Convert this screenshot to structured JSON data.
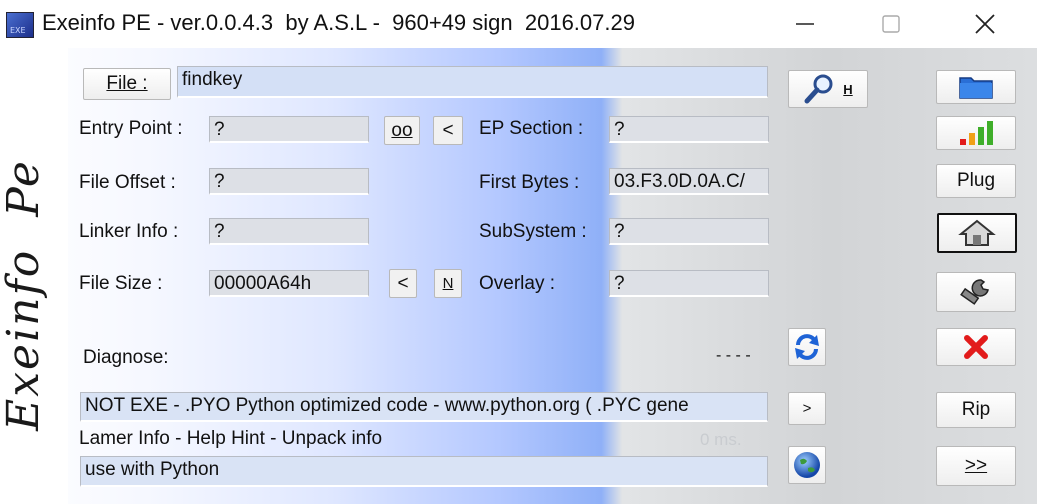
{
  "window": {
    "title": "Exeinfo PE - ver.0.0.4.3  by A.S.L -  960+49 sign  2016.07.29",
    "icon_label": "EXE"
  },
  "file": {
    "button_label": "File :",
    "value": "findkey"
  },
  "logo_text": "Exeinfo  Pe",
  "fields": {
    "entry_point_label": "Entry Point :",
    "entry_point_value": "?",
    "oo_label": "oo",
    "lt_label": "<",
    "ep_section_label": "EP Section :",
    "ep_section_value": "?",
    "file_offset_label": "File Offset :",
    "file_offset_value": "?",
    "first_bytes_label": "First Bytes :",
    "first_bytes_value": "03.F3.0D.0A.C/",
    "linker_info_label": "Linker Info :",
    "linker_info_value": "?",
    "subsystem_label": "SubSystem :",
    "subsystem_value": "?",
    "file_size_label": "File Size :",
    "file_size_value": "00000A64h",
    "lt2_label": "<",
    "n_label": "N",
    "overlay_label": "Overlay :",
    "overlay_value": "?"
  },
  "diagnose": {
    "label": "Diagnose:",
    "dashes": "- - - -",
    "result": "NOT EXE - .PYO  Python optimized code - www.python.org ( .PYC gene",
    "more_label": ">"
  },
  "lamer": {
    "label": "Lamer Info - Help Hint - Unpack info",
    "time": "0 ms.",
    "hint": "use with Python"
  },
  "side_buttons": {
    "h_label": "H",
    "plug_label": "Plug",
    "rip_label": "Rip",
    "next_label": ">>"
  },
  "icons": [
    "folder-icon",
    "bar-chart-icon",
    "home-icon",
    "wrench-icon",
    "red-x-icon",
    "refresh-icon",
    "globe-icon",
    "magnifier-icon"
  ],
  "colors": {
    "accent_blue": "#2a6fd6",
    "red": "#e21b1b",
    "green": "#3fae2a"
  }
}
